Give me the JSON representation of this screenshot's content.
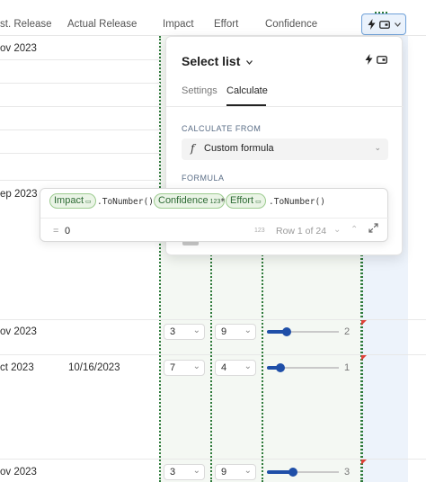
{
  "columns": {
    "est_release": "st. Release",
    "actual_release": "Actual Release",
    "impact": "Impact",
    "effort": "Effort",
    "confidence": "Confidence"
  },
  "rows": [
    {
      "est": "ov 2023",
      "actual": ""
    },
    {
      "est": "ep 2023",
      "actual": ""
    },
    {
      "est": "ov 2023",
      "actual": "",
      "impact": "3",
      "effort": "9",
      "confidence": 2,
      "confidence_label": "2"
    },
    {
      "est": "ct 2023",
      "actual": "10/16/2023",
      "impact": "7",
      "effort": "4",
      "confidence": 1,
      "confidence_label": "1"
    },
    {
      "est": "ov 2023",
      "actual": "",
      "impact": "3",
      "effort": "9",
      "confidence": 3,
      "confidence_label": "3"
    }
  ],
  "slider_max": 10,
  "panel": {
    "title": "Select list",
    "tabs": [
      "Settings",
      "Calculate"
    ],
    "active_tab": "Calculate",
    "calculate_from_label": "CALCULATE FROM",
    "calculate_from_value": "Custom formula",
    "formula_label": "FORMULA"
  },
  "formula": {
    "chip1": "Impact",
    "text1": ".ToNumber()*",
    "chip2": "Confidence",
    "chip2_icon": "123",
    "text2": "*",
    "chip3": "Effort",
    "text3": ".ToNumber()",
    "result_prefix": "=",
    "result": "0",
    "result_type": "123",
    "row_indicator": "Row 1 of 24"
  },
  "icons": {
    "lightning": "lightning-icon",
    "column_type": "select-column-icon",
    "expand": "expand-icon"
  },
  "colors": {
    "accent_blue": "#1f4fa8",
    "chip_green": "#2e6b35",
    "chip_bg": "#eaf4e6",
    "dotted_border": "#2e7a3a",
    "flag_red": "#e0413a"
  }
}
